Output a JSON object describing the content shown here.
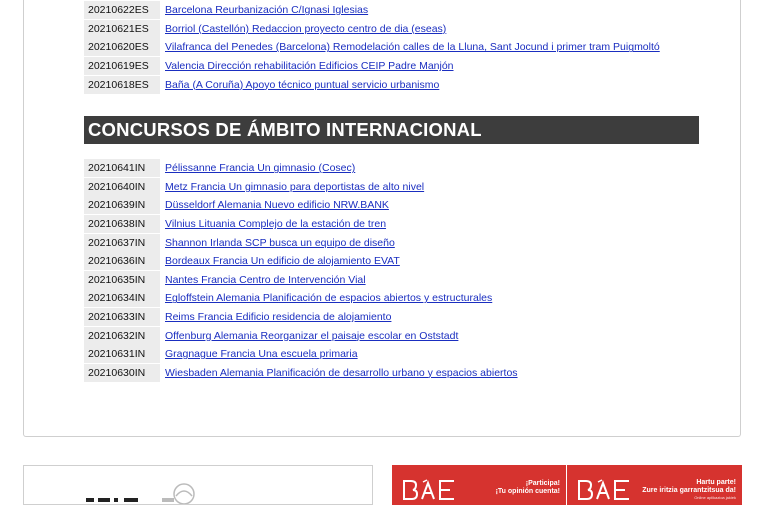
{
  "national_list": [
    {
      "code": "20210622ES",
      "title": "Barcelona Reurbanización C/Ignasi Iglesias"
    },
    {
      "code": "20210621ES",
      "title": "Borriol (Castellón) Redaccion proyecto centro de dia (eseas)"
    },
    {
      "code": "20210620ES",
      "title": "Vilafranca del Penedes (Barcelona) Remodelación calles de la Lluna, Sant Jocund i primer tram Puigmoltó"
    },
    {
      "code": "20210619ES",
      "title": "Valencia Dirección rehabilitación Edificios CEIP Padre Manjón "
    },
    {
      "code": "20210618ES",
      "title": "Baña (A Coruña) Apoyo técnico puntual servicio urbanismo"
    }
  ],
  "international_section": {
    "heading": "CONCURSOS DE ÁMBITO INTERNACIONAL",
    "items": [
      {
        "code": "20210641IN",
        "title": "Pélissanne Francia Un gimnasio (Cosec)"
      },
      {
        "code": "20210640IN",
        "title": "Metz Francia Un gimnasio para deportistas de alto nivel "
      },
      {
        "code": "20210639IN",
        "title": "Düsseldorf Alemania Nuevo edificio NRW.BANK"
      },
      {
        "code": "20210638IN",
        "title": "Vilnius Lituania Complejo de la estación de tren "
      },
      {
        "code": "20210637IN",
        "title": "Shannon Irlanda SCP busca un equipo de diseño "
      },
      {
        "code": "20210636IN",
        "title": "Bordeaux Francia Un edificio de alojamiento EVAT"
      },
      {
        "code": "20210635IN",
        "title": "Nantes Francia Centro de Intervención Vial "
      },
      {
        "code": "20210634IN",
        "title": "Egloffstein Alemania Planificación de espacios abiertos y estructurales"
      },
      {
        "code": "20210633IN",
        "title": "Reims Francia Edificio residencia de alojamiento"
      },
      {
        "code": "20210632IN",
        "title": "Offenburg Alemania Reorganizar el paisaje escolar en Oststadt "
      },
      {
        "code": "20210631IN",
        "title": "Gragnague Francia Una escuela primaria"
      },
      {
        "code": "20210630IN",
        "title": "Wiesbaden Alemania Planificación de desarrollo urbano y espacios abiertos "
      }
    ]
  },
  "banners": {
    "middle": {
      "logo": "BAE",
      "line1": "¡Participa!",
      "line2": "¡Tu opinión cuenta!"
    },
    "right": {
      "logo": "BAE",
      "line1": "Hartu parte!",
      "line2": "Zure iritzia garrantzitsua da!",
      "line3": "Online aplikazioa jakiek"
    }
  },
  "colors": {
    "link": "#1a2ec0",
    "header_bg": "#3d3d3d",
    "code_bg": "#ececec",
    "banner_red": "#d6332f"
  }
}
